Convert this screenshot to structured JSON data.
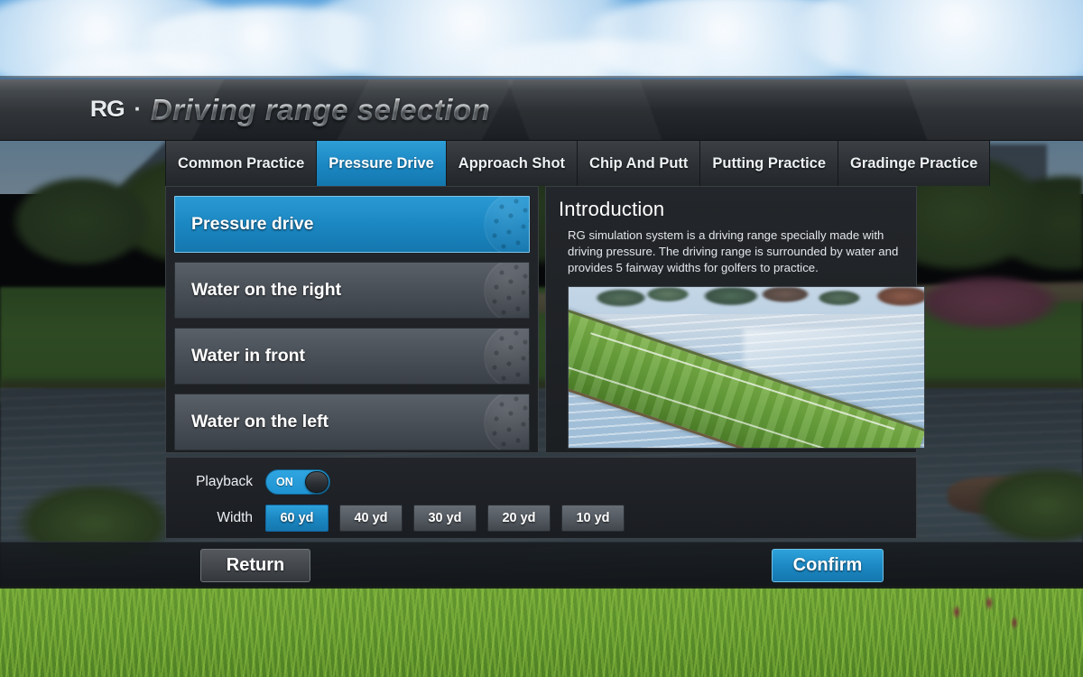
{
  "header": {
    "logo": "RG",
    "logo_separator": "·",
    "title": "Driving range selection"
  },
  "tabs": [
    {
      "label": "Common Practice",
      "active": false
    },
    {
      "label": "Pressure Drive",
      "active": true
    },
    {
      "label": "Approach Shot",
      "active": false
    },
    {
      "label": "Chip And Putt",
      "active": false
    },
    {
      "label": "Putting Practice",
      "active": false
    },
    {
      "label": "Gradinge Practice",
      "active": false
    }
  ],
  "range_list": [
    {
      "label": "Pressure drive",
      "selected": true
    },
    {
      "label": "Water on the right",
      "selected": false
    },
    {
      "label": "Water in front",
      "selected": false
    },
    {
      "label": "Water on the left",
      "selected": false
    }
  ],
  "introduction": {
    "title": "Introduction",
    "text": "RG simulation system is a driving range specially made with driving pressure. The driving range is surrounded by water and provides 5 fairway widths for golfers to practice."
  },
  "options": {
    "playback_label": "Playback",
    "playback_state": "ON",
    "playback_on": true,
    "width_label": "Width",
    "width_options": [
      {
        "label": "60 yd",
        "active": true
      },
      {
        "label": "40 yd",
        "active": false
      },
      {
        "label": "30 yd",
        "active": false
      },
      {
        "label": "20 yd",
        "active": false
      },
      {
        "label": "10 yd",
        "active": false
      }
    ]
  },
  "footer": {
    "return_label": "Return",
    "confirm_label": "Confirm"
  },
  "colors": {
    "accent_blue": "#1b87c2",
    "toggle_blue": "#2fa5e0",
    "panel_dark": "#1c1f22",
    "item_gray": "#4a5057"
  }
}
